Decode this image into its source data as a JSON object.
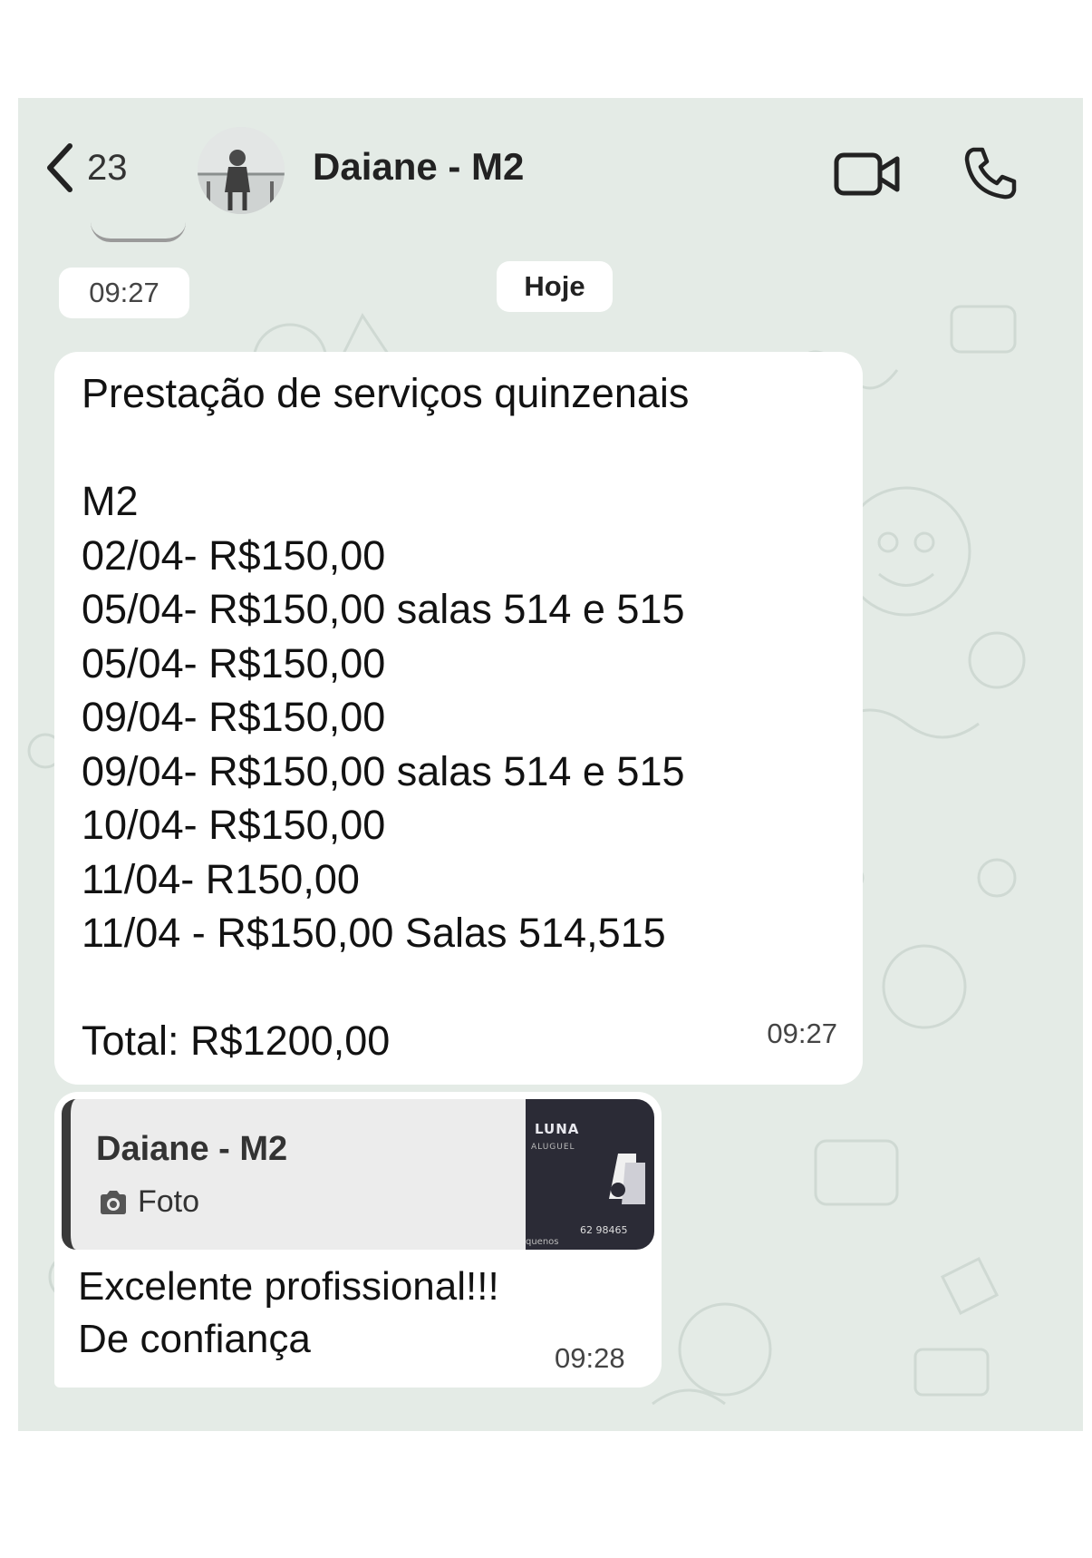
{
  "header": {
    "back_count": "23",
    "contact_name": "Daiane - M2",
    "icons": [
      "chevron-left-icon",
      "video-call-icon",
      "phone-icon"
    ]
  },
  "chat": {
    "floating_time": "09:27",
    "date_separator": "Hoje",
    "message1": {
      "text": "Prestação de serviços quinzenais\n\nM2\n02/04- R$150,00\n05/04- R$150,00 salas 514 e 515\n05/04- R$150,00\n09/04- R$150,00\n09/04- R$150,00 salas 514 e 515\n10/04- R$150,00\n11/04- R150,00\n11/04 - R$150,00 Salas 514,515\n\nTotal: R$1200,00",
      "time": "09:27"
    },
    "message2": {
      "quote": {
        "author": "Daiane - M2",
        "type_label": "Foto",
        "type_icon": "camera-icon",
        "thumbnail": {
          "line1": "LUNA",
          "line2": "ALUGUEL",
          "phone_partial": "62 98465",
          "footer_partial": "quenos"
        }
      },
      "text": "Excelente profissional!!!\nDe confiança",
      "time": "09:28"
    }
  },
  "colors": {
    "wallpaper": "#e4ebe6",
    "bubble": "#ffffff",
    "quote_bar": "#3a3a3a",
    "quote_bg": "#ececec"
  }
}
